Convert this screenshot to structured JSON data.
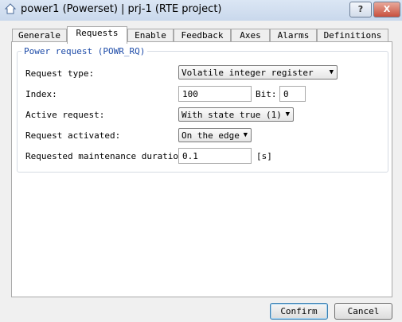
{
  "window": {
    "title": "power1 (Powerset) | prj-1 (RTE project)",
    "help_label": "?",
    "close_label": "X"
  },
  "tabs": [
    {
      "label": "Generale"
    },
    {
      "label": "Requests"
    },
    {
      "label": "Enable"
    },
    {
      "label": "Feedback"
    },
    {
      "label": "Axes"
    },
    {
      "label": "Alarms"
    },
    {
      "label": "Definitions"
    }
  ],
  "active_tab": "Requests",
  "group": {
    "title": "Power request (POWR_RQ)",
    "request_type": {
      "label": "Request type:",
      "value": "Volatile integer register"
    },
    "index": {
      "label": "Index:",
      "value": "100"
    },
    "bit": {
      "label": "Bit:",
      "value": "0"
    },
    "active_request": {
      "label": "Active request:",
      "value": "With state true (1)"
    },
    "request_activated": {
      "label": "Request activated:",
      "value": "On the edge"
    },
    "maintenance": {
      "label": "Requested maintenance duration:",
      "value": "0.1",
      "unit": "[s]"
    }
  },
  "buttons": {
    "confirm": "Confirm",
    "cancel": "Cancel"
  }
}
